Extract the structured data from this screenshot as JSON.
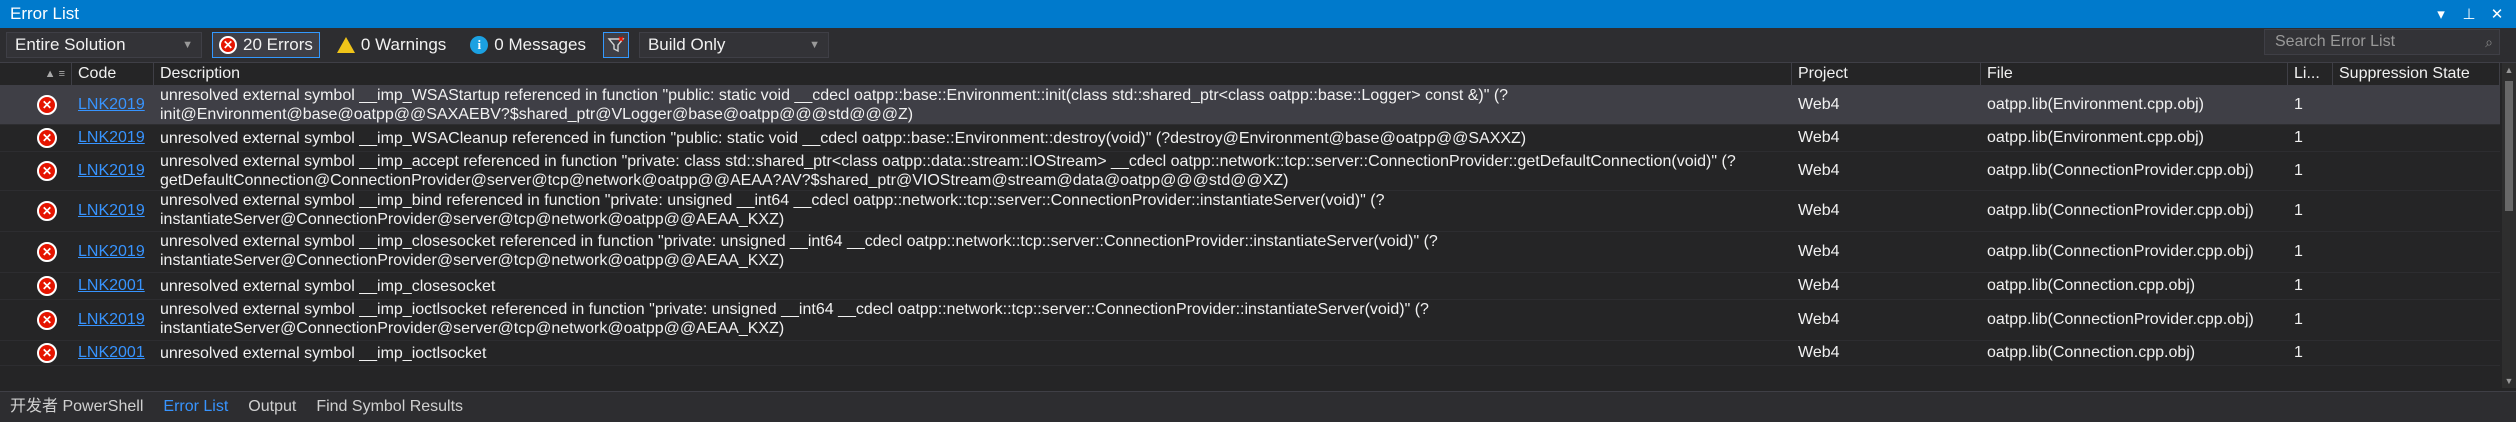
{
  "window": {
    "title": "Error List",
    "pin_icon": "pin-icon",
    "close_icon": "close-icon"
  },
  "toolbar": {
    "scope": "Entire Solution",
    "errors": "20 Errors",
    "warnings": "0 Warnings",
    "messages": "0 Messages",
    "build_filter": "Build Only",
    "search_placeholder": "Search Error List"
  },
  "columns": {
    "code": "Code",
    "description": "Description",
    "project": "Project",
    "file": "File",
    "line": "Li...",
    "suppression": "Suppression State"
  },
  "rows": [
    {
      "code": "LNK2019",
      "desc1": "unresolved external symbol __imp_WSAStartup referenced in function \"public: static void __cdecl oatpp::base::Environment::init(class std::shared_ptr<class oatpp::base::Logger> const &)\" (?",
      "desc2": "init@Environment@base@oatpp@@SAXAEBV?$shared_ptr@VLogger@base@oatpp@@@std@@@Z)",
      "project": "Web4",
      "file": "oatpp.lib(Environment.cpp.obj)",
      "line": "1"
    },
    {
      "code": "LNK2019",
      "desc1": "unresolved external symbol __imp_WSACleanup referenced in function \"public: static void __cdecl oatpp::base::Environment::destroy(void)\" (?destroy@Environment@base@oatpp@@SAXXZ)",
      "desc2": "",
      "project": "Web4",
      "file": "oatpp.lib(Environment.cpp.obj)",
      "line": "1"
    },
    {
      "code": "LNK2019",
      "desc1": "unresolved external symbol __imp_accept referenced in function \"private: class std::shared_ptr<class oatpp::data::stream::IOStream> __cdecl oatpp::network::tcp::server::ConnectionProvider::getDefaultConnection(void)\" (?",
      "desc2": "getDefaultConnection@ConnectionProvider@server@tcp@network@oatpp@@AEAA?AV?$shared_ptr@VIOStream@stream@data@oatpp@@@std@@XZ)",
      "project": "Web4",
      "file": "oatpp.lib(ConnectionProvider.cpp.obj)",
      "line": "1"
    },
    {
      "code": "LNK2019",
      "desc1": "unresolved external symbol __imp_bind referenced in function \"private: unsigned __int64 __cdecl oatpp::network::tcp::server::ConnectionProvider::instantiateServer(void)\" (?",
      "desc2": "instantiateServer@ConnectionProvider@server@tcp@network@oatpp@@AEAA_KXZ)",
      "project": "Web4",
      "file": "oatpp.lib(ConnectionProvider.cpp.obj)",
      "line": "1"
    },
    {
      "code": "LNK2019",
      "desc1": "unresolved external symbol __imp_closesocket referenced in function \"private: unsigned __int64 __cdecl oatpp::network::tcp::server::ConnectionProvider::instantiateServer(void)\" (?",
      "desc2": "instantiateServer@ConnectionProvider@server@tcp@network@oatpp@@AEAA_KXZ)",
      "project": "Web4",
      "file": "oatpp.lib(ConnectionProvider.cpp.obj)",
      "line": "1"
    },
    {
      "code": "LNK2001",
      "desc1": "unresolved external symbol __imp_closesocket",
      "desc2": "",
      "project": "Web4",
      "file": "oatpp.lib(Connection.cpp.obj)",
      "line": "1"
    },
    {
      "code": "LNK2019",
      "desc1": "unresolved external symbol __imp_ioctlsocket referenced in function \"private: unsigned __int64 __cdecl oatpp::network::tcp::server::ConnectionProvider::instantiateServer(void)\" (?",
      "desc2": "instantiateServer@ConnectionProvider@server@tcp@network@oatpp@@AEAA_KXZ)",
      "project": "Web4",
      "file": "oatpp.lib(ConnectionProvider.cpp.obj)",
      "line": "1"
    },
    {
      "code": "LNK2001",
      "desc1": "unresolved external symbol __imp_ioctlsocket",
      "desc2": "",
      "project": "Web4",
      "file": "oatpp.lib(Connection.cpp.obj)",
      "line": "1"
    }
  ],
  "tabs": [
    "开发者 PowerShell",
    "Error List",
    "Output",
    "Find Symbol Results"
  ],
  "colors": {
    "accent": "#007acc",
    "error": "#e51400",
    "link": "#3794ff"
  }
}
